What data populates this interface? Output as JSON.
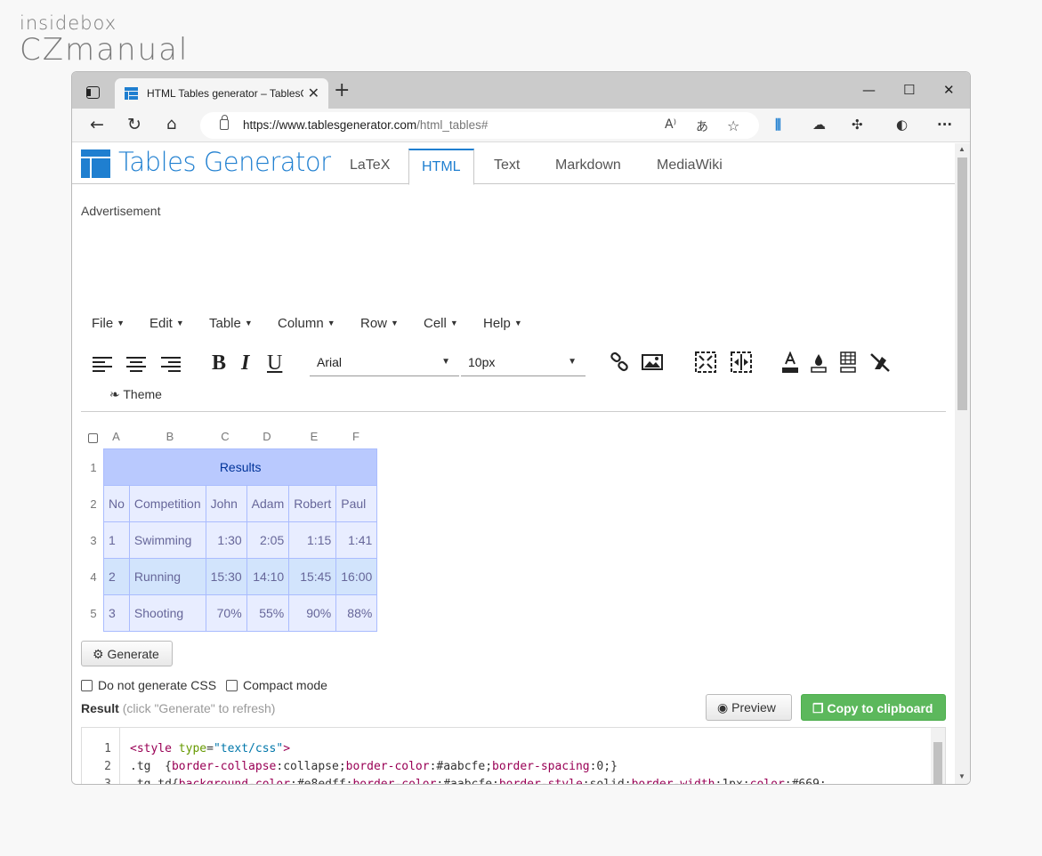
{
  "watermark": {
    "line1": "insidebox",
    "line2": "CZmanual"
  },
  "browser": {
    "tab_title": "HTML Tables generator – TablesGenerator.com",
    "new_tab": "+",
    "minimize": "—",
    "maximize": "☐",
    "close": "✕",
    "url_host": "https://www.tablesgenerator.com",
    "url_path": "/html_tables#"
  },
  "site": {
    "logo_text": "Tables Generator",
    "tabs": [
      "LaTeX",
      "HTML",
      "Text",
      "Markdown",
      "MediaWiki"
    ],
    "active_tab": "HTML",
    "advertisement": "Advertisement"
  },
  "menu": [
    "File",
    "Edit",
    "Table",
    "Column",
    "Row",
    "Cell",
    "Help"
  ],
  "toolbar": {
    "bold": "B",
    "italic": "I",
    "underline": "U",
    "font_family": "Arial",
    "font_size": "10px",
    "theme_label": "Theme"
  },
  "grid": {
    "column_headers": [
      "A",
      "B",
      "C",
      "D",
      "E",
      "F"
    ],
    "row_headers": [
      "1",
      "2",
      "3",
      "4",
      "5"
    ],
    "title_row": "Results",
    "header_row": [
      "No",
      "Competition",
      "John",
      "Adam",
      "Robert",
      "Paul"
    ],
    "rows": [
      [
        "1",
        "Swimming",
        "1:30",
        "2:05",
        "1:15",
        "1:41"
      ],
      [
        "2",
        "Running",
        "15:30",
        "14:10",
        "15:45",
        "16:00"
      ],
      [
        "3",
        "Shooting",
        "70%",
        "55%",
        "90%",
        "88%"
      ]
    ]
  },
  "actions": {
    "generate": "Generate",
    "no_css": "Do not generate CSS",
    "compact": "Compact mode",
    "result_label": "Result",
    "result_hint": "(click \"Generate\" to refresh)",
    "preview": "Preview",
    "copy": "Copy to clipboard"
  },
  "code": {
    "line_numbers": [
      "1",
      "2",
      "3"
    ]
  },
  "colors": {
    "brand": "#1f7fd0",
    "table_header_bg": "#b9c9fe",
    "table_border": "#aabcfe",
    "table_odd_bg": "#e8edff",
    "table_even_bg": "#d2e4fc",
    "copy_button": "#5cb85c"
  }
}
